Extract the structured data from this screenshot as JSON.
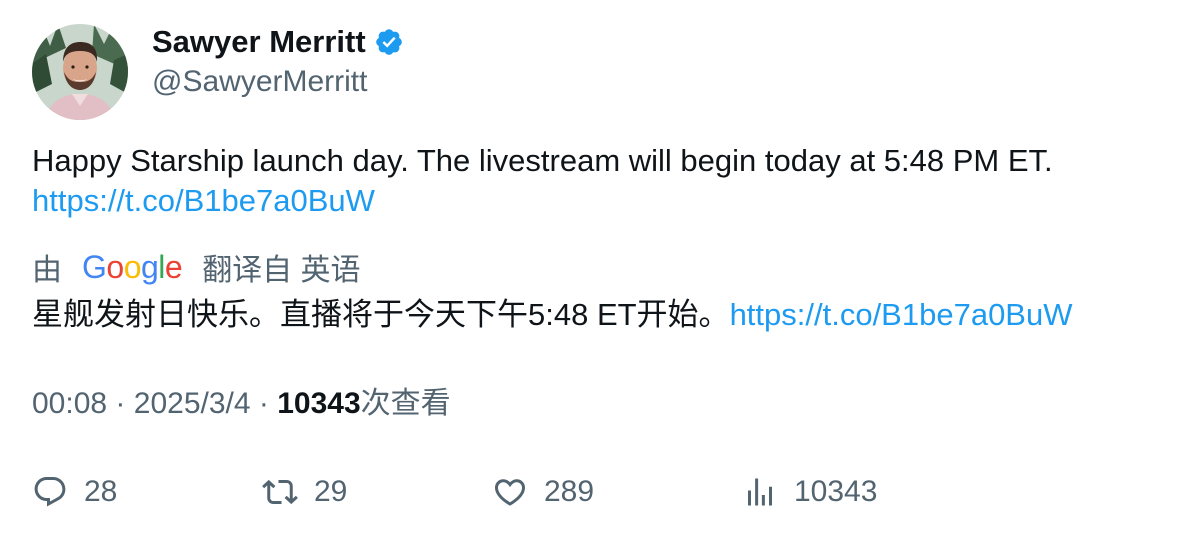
{
  "author": {
    "display_name": "Sawyer Merritt",
    "handle": "@SawyerMerritt",
    "verified_color": "#1d9bf0"
  },
  "tweet": {
    "text": "Happy Starship launch day. The livestream will begin today at 5:48 PM ET.",
    "link": "https://t.co/B1be7a0BuW"
  },
  "translation": {
    "prefix": "由",
    "provider": "Google",
    "suffix": "翻译自 英语",
    "text": "星舰发射日快乐。直播将于今天下午5:48 ET开始。",
    "link": "https://t.co/B1be7a0BuW"
  },
  "meta": {
    "time": "00:08",
    "separator": "·",
    "date": "2025/3/4",
    "views_count": "10343",
    "views_label": "次查看"
  },
  "actions": {
    "replies": "28",
    "retweets": "29",
    "likes": "289",
    "views": "10343"
  },
  "icons": [
    "verified-badge-icon",
    "reply-icon",
    "retweet-icon",
    "like-icon",
    "views-icon"
  ],
  "colors": {
    "link": "#1d9bf0",
    "secondary_text": "#536471",
    "primary_text": "#0f1419"
  }
}
